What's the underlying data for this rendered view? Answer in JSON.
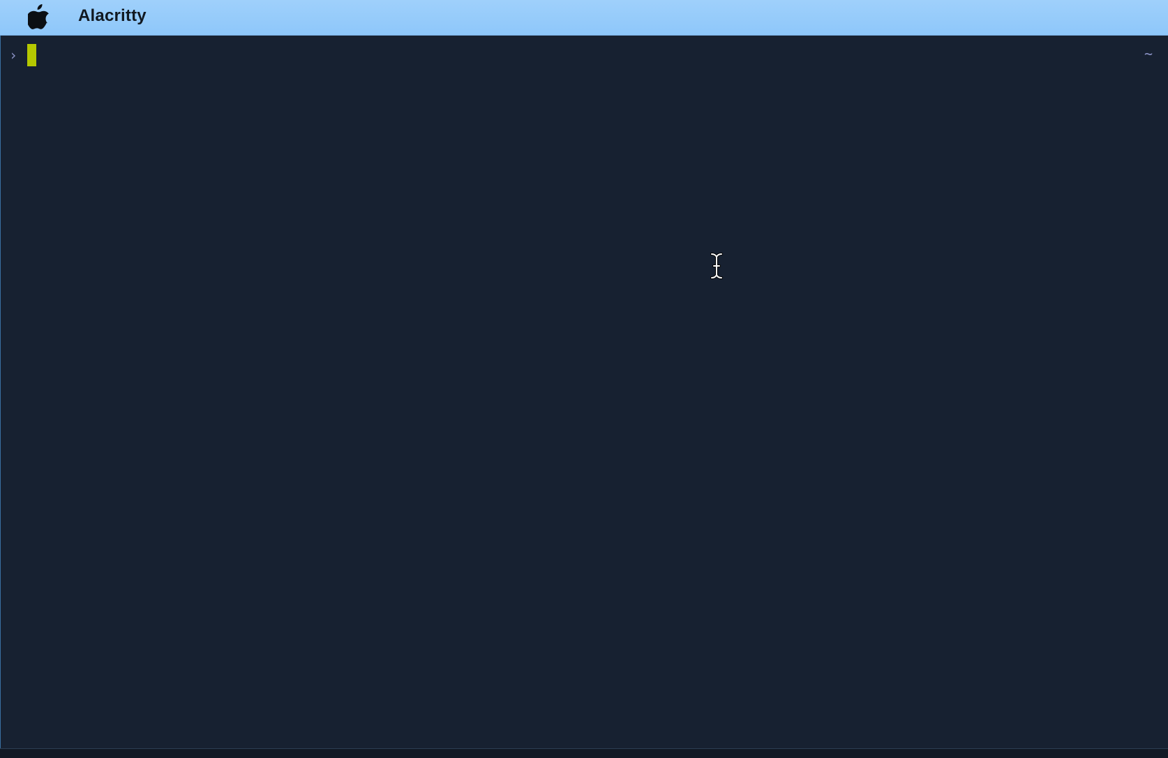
{
  "menubar": {
    "apple_icon": "apple-icon",
    "app_name": "Alacritty"
  },
  "terminal": {
    "prompt_symbol": "›",
    "right_prompt": "~",
    "cursor_color": "#b5c800",
    "background_color": "#172131",
    "prompt_color": "#8b93c6"
  },
  "pointer": {
    "icon": "ibeam-cursor-icon"
  }
}
